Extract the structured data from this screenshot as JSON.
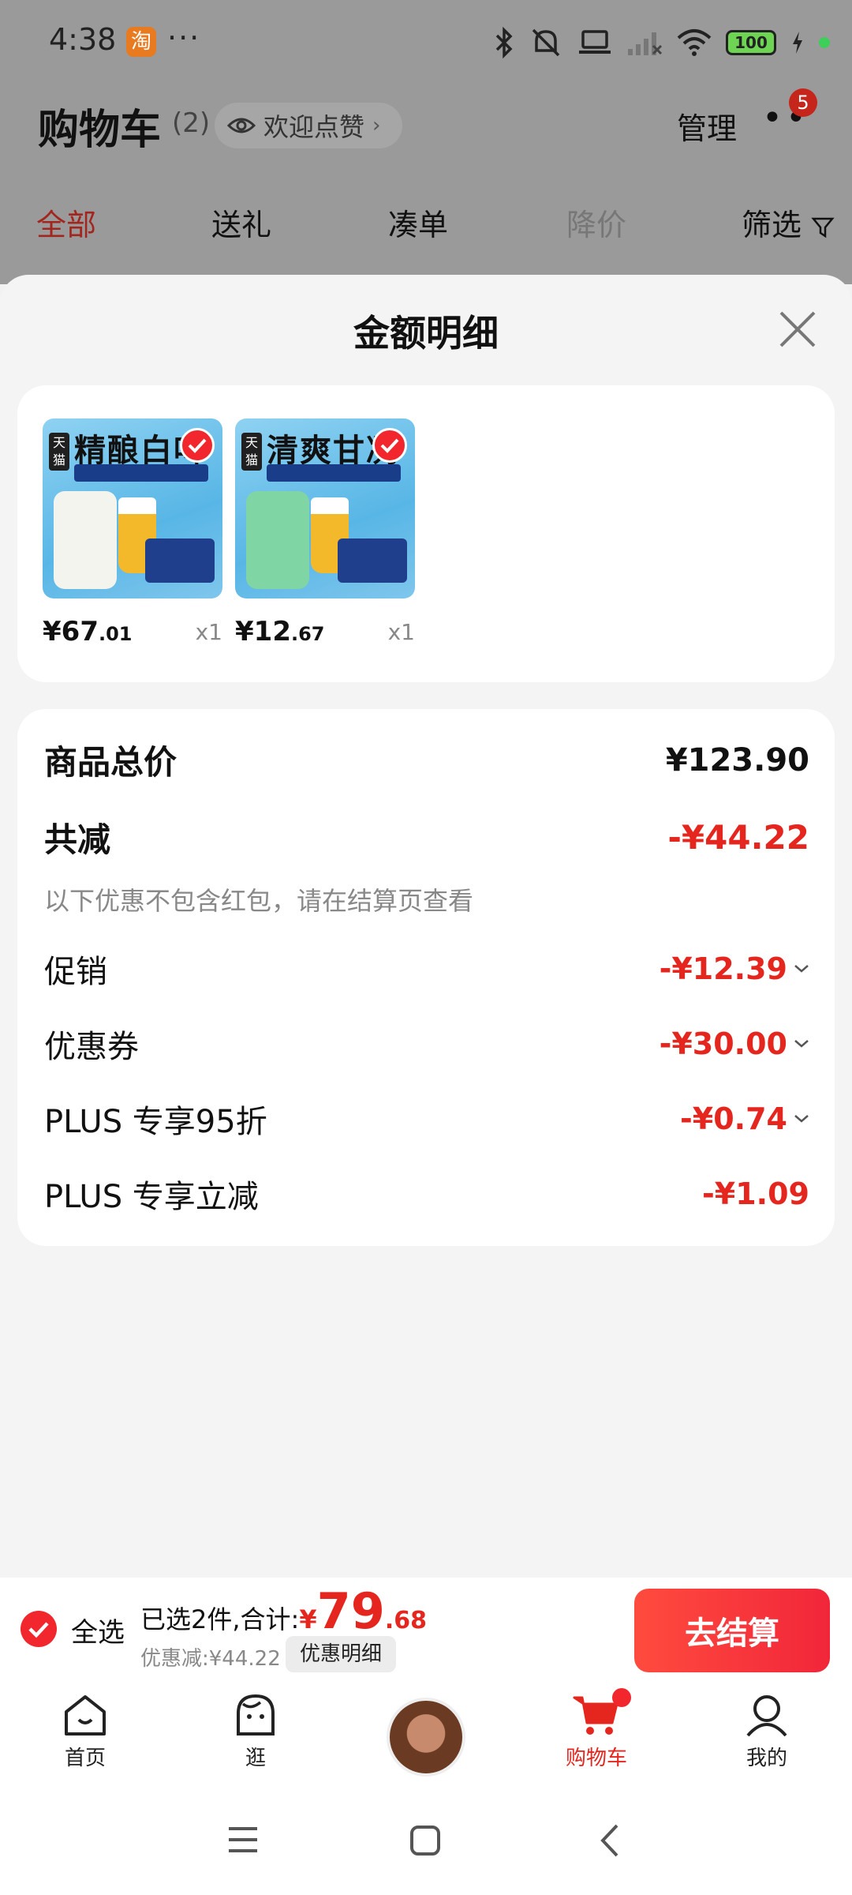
{
  "status_bar": {
    "time": "4:38",
    "app_badge": "淘",
    "battery": "100"
  },
  "background": {
    "title": "购物车",
    "count": "(2)",
    "like_label": "欢迎点赞",
    "manage": "管理",
    "more_badge": "5",
    "tabs": [
      {
        "label": "全部",
        "state": "active"
      },
      {
        "label": "送礼",
        "state": "normal"
      },
      {
        "label": "凑单",
        "state": "normal"
      },
      {
        "label": "降价",
        "state": "muted"
      },
      {
        "label": "筛选",
        "state": "normal"
      }
    ]
  },
  "sheet": {
    "title": "金额明细",
    "products": [
      {
        "headline": "精酿白啤",
        "price_main": "¥67",
        "price_dec": ".01",
        "qty": "x1",
        "can_color": "#f4f4ee"
      },
      {
        "headline": "清爽甘冽",
        "price_main": "¥12",
        "price_dec": ".67",
        "qty": "x1",
        "can_color": "#7fd6a4"
      }
    ],
    "total_label": "商品总价",
    "total_value": "¥123.90",
    "reduce_label": "共减",
    "reduce_value": "-¥44.22",
    "note": "以下优惠不包含红包，请在结算页查看",
    "lines": [
      {
        "label": "促销",
        "value": "-¥12.39",
        "expandable": true
      },
      {
        "label": "优惠券",
        "value": "-¥30.00",
        "expandable": true
      },
      {
        "label": "PLUS 专享95折",
        "value": "-¥0.74",
        "expandable": true
      },
      {
        "label": "PLUS 专享立减",
        "value": "-¥1.09",
        "expandable": false
      }
    ]
  },
  "checkout": {
    "select_all": "全选",
    "selected_text": "已选2件,合计:",
    "currency": "¥",
    "amount_int": "79",
    "amount_dec": ".68",
    "discount_text": "优惠减:¥44.22",
    "detail_chip": "优惠明细",
    "button": "去结算"
  },
  "nav": {
    "home": "首页",
    "browse": "逛",
    "cart": "购物车",
    "me": "我的"
  },
  "colors": {
    "accent": "#e5261f",
    "check": "#f2272d"
  }
}
